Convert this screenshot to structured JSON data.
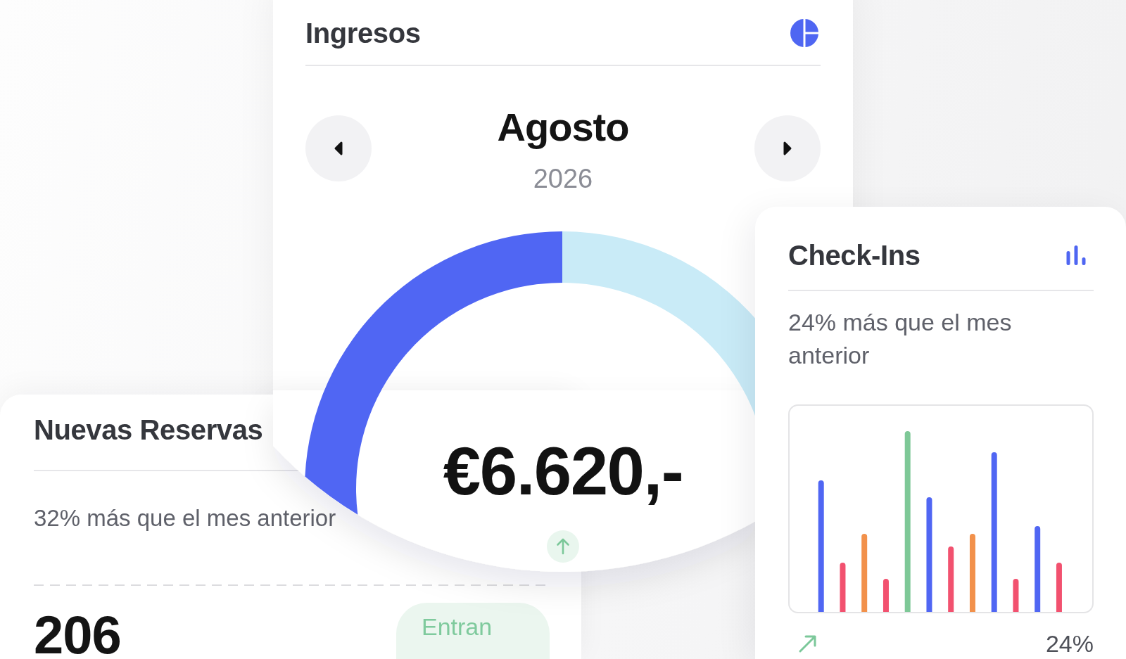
{
  "revenue_card": {
    "title": "Ingresos",
    "month": "Agosto",
    "year": "2026",
    "amount": "€6.620,-"
  },
  "bookings_card": {
    "title": "Nuevas Reservas",
    "comparison": "32% más que el mes anterior",
    "count": "206",
    "badge": "Entran"
  },
  "checkins_card": {
    "title": "Check-Ins",
    "comparison": "24% más que el mes anterior",
    "change": "24%"
  }
}
